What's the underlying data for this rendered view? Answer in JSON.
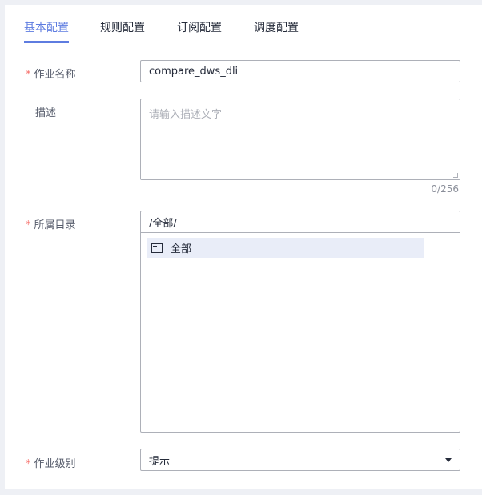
{
  "tabs": [
    {
      "label": "基本配置"
    },
    {
      "label": "规则配置"
    },
    {
      "label": "订阅配置"
    },
    {
      "label": "调度配置"
    }
  ],
  "form": {
    "required_mark": "*",
    "job_name": {
      "label": "作业名称",
      "value": "compare_dws_dli"
    },
    "description": {
      "label": "描述",
      "placeholder": "请输入描述文字",
      "count": "0/256"
    },
    "directory": {
      "label": "所属目录",
      "path": "/全部/",
      "tree": [
        {
          "label": "全部"
        }
      ]
    },
    "job_level": {
      "label": "作业级别",
      "value": "提示"
    }
  }
}
